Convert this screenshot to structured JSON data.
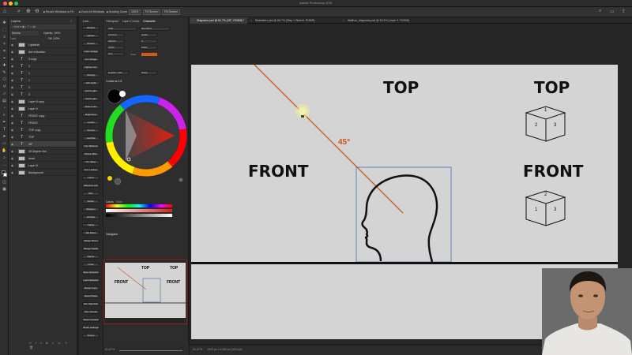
{
  "window": {
    "title": "Adobe Photoshop 2021"
  },
  "options_bar": {
    "resize_windows_label": "Resize Windows to Fit",
    "zoom_all_label": "Zoom All Windows",
    "scrubby_zoom_label": "Scrubby Zoom",
    "zoom_value": "100%",
    "fit_screen_label": "Fit Screen",
    "fill_screen_label": "Fill Screen"
  },
  "layers_panel": {
    "tab": "Layers",
    "blend_mode": "Normal",
    "opacity": "Opacity: 100%",
    "lock_label": "Lock:",
    "fill": "Fill: 100%",
    "layers": [
      {
        "name": "Lightbulb",
        "type": "image"
      },
      {
        "name": "line Indication",
        "type": "image"
      },
      {
        "name": "3 copy",
        "type": "text"
      },
      {
        "name": "2",
        "type": "text"
      },
      {
        "name": "1",
        "type": "text"
      },
      {
        "name": "1",
        "type": "text"
      },
      {
        "name": "2",
        "type": "text"
      },
      {
        "name": "3",
        "type": "text"
      },
      {
        "name": "Layer 6 copy",
        "type": "image"
      },
      {
        "name": "Layer 6",
        "type": "image"
      },
      {
        "name": "FRONT copy",
        "type": "text"
      },
      {
        "name": "FRONT",
        "type": "text"
      },
      {
        "name": "TOP copy",
        "type": "text"
      },
      {
        "name": "TOP",
        "type": "text"
      },
      {
        "name": "45°",
        "type": "text",
        "selected": true
      },
      {
        "name": "45 Degree line",
        "type": "image"
      },
      {
        "name": "head",
        "type": "image"
      },
      {
        "name": "Layer 8",
        "type": "image"
      },
      {
        "name": "Background",
        "type": "image"
      }
    ]
  },
  "styles_panel": {
    "header": "Lum...",
    "items": [
      "Multiply",
      "Lighten",
      "Screen",
      "Color Dodge",
      "Lin. Dodge",
      "Lighter Col.",
      "Overlay",
      "Soft Light",
      "Hard Light",
      "Vivid Light",
      "Solid Color",
      "Brightness",
      "Levels",
      "Curves",
      "Hue/Sat",
      "Col. Balance",
      "Photo Filter",
      "Ch. Mixer",
      "Col. Lookup",
      "Invert",
      "Selective Col.",
      "Blur",
      "Soften",
      "Sharpen",
      "Hi-Pass",
      "Clarity",
      "Sat Boost",
      "Merge Down",
      "Merge Visible",
      "Stamp",
      "Grow",
      "Save Selection",
      "Load Selection",
      "Reset Copy",
      "Reset Paste",
      "Sel. Selection",
      "Sel. Inverse",
      "Reset Camera",
      "Brush Settings",
      "Arrays"
    ]
  },
  "character_panel": {
    "tabs": [
      "Histogram",
      "Layer Comps",
      "Character"
    ],
    "font_family": "Arial",
    "font_style": "Semibold",
    "font_size": "16.04 pt",
    "leading": "(Auto)",
    "kerning": "Metrics",
    "tracking": "0",
    "vertical_scale": "100%",
    "horizontal_scale": "100%",
    "baseline": "0 pt",
    "color_label": "Color:",
    "language": "English: USA",
    "antialias": "Sharp",
    "text_color": "#d35a1a"
  },
  "coolorus": {
    "title": "Coolorus 2.5"
  },
  "color_panel": {
    "tabs": [
      "Colors",
      "Mixer"
    ]
  },
  "navigator": {
    "tab": "Navigator",
    "zoom": "61.67%"
  },
  "documents": {
    "tabs": [
      {
        "label": "Diagrams.psd @ 61.7% (45°, RGB/8) *",
        "active": true
      },
      {
        "label": "Illustration.psd @ 66.7% (Step 1 Sketch, RGB/8)",
        "active": false
      },
      {
        "label": "Mailbox_diagrams.psd @ 33.3% (Layer 2, RGB/8)",
        "active": false
      }
    ]
  },
  "canvas": {
    "top_label_left": "TOP",
    "top_label_right": "TOP",
    "front_label_left": "FRONT",
    "front_label_right": "FRONT",
    "angle_label": "45°",
    "cube_top_faces": [
      "1",
      "2",
      "3"
    ],
    "cube_front_faces": [
      "2",
      "1",
      "3"
    ],
    "accent_color": "#c85418"
  },
  "status_bar": {
    "zoom": "61.67%",
    "doc_info": "1920 px x 1080 px (200 ppi)"
  }
}
